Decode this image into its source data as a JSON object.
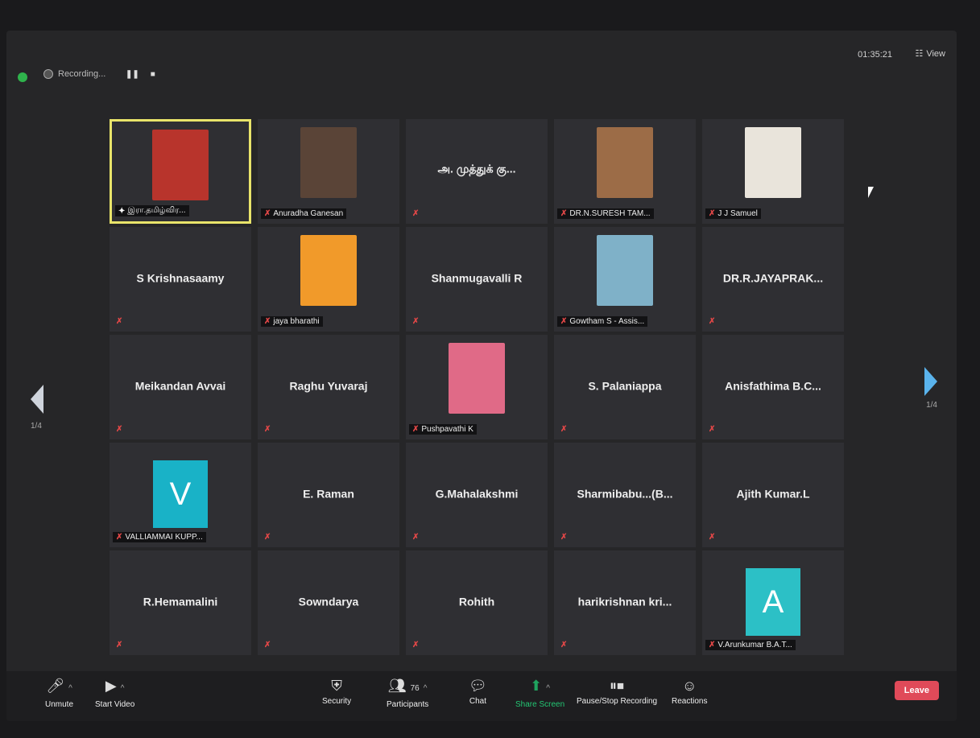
{
  "topbar": {
    "recording_label": "Recording...",
    "pause_icon": "pause-icon",
    "stop_icon": "stop-icon",
    "timer": "01:35:21",
    "view_label": "View"
  },
  "pages": {
    "left": "1/4",
    "right": "1/4"
  },
  "tiles": [
    {
      "name": "இரா.தமிழ்விர...",
      "photo": true,
      "active": true,
      "photo_color": "#b8342c"
    },
    {
      "name": "Anuradha Ganesan",
      "photo": true,
      "photo_color": "#5a4437"
    },
    {
      "name": "அ. முத்துக் கு...",
      "center": true
    },
    {
      "name": "DR.N.SURESH TAM...",
      "photo": true,
      "photo_color": "#9c6c47"
    },
    {
      "name": "J J Samuel",
      "photo": true,
      "photo_color": "#e9e4db"
    },
    {
      "name": "S Krishnasaamy",
      "center": true
    },
    {
      "name": "jaya bharathi",
      "photo": true,
      "photo_color": "#f19a2a"
    },
    {
      "name": "Shanmugavalli R",
      "center": true
    },
    {
      "name": "Gowtham S - Assis...",
      "photo": true,
      "photo_color": "#7fb1c8"
    },
    {
      "name": "DR.R.JAYAPRAK...",
      "center": true
    },
    {
      "name": "Meikandan Avvai",
      "center": true
    },
    {
      "name": "Raghu Yuvaraj",
      "center": true
    },
    {
      "name": "Pushpavathi K",
      "photo": true,
      "photo_color": "#e06a87"
    },
    {
      "name": "S. Palaniappa",
      "center": true
    },
    {
      "name": "Anisfathima B.C...",
      "center": true
    },
    {
      "name": "VALLIAMMAI KUPP...",
      "avatar": "V",
      "avatar_color": "#19b2c7"
    },
    {
      "name": "E. Raman",
      "center": true
    },
    {
      "name": "G.Mahalakshmi",
      "center": true
    },
    {
      "name": "Sharmibabu...(B...",
      "center": true
    },
    {
      "name": "Ajith Kumar.L",
      "center": true
    },
    {
      "name": "R.Hemamalini",
      "center": true
    },
    {
      "name": "Sowndarya",
      "center": true
    },
    {
      "name": "Rohith",
      "center": true
    },
    {
      "name": "harikrishnan kri...",
      "center": true
    },
    {
      "name": "V.Arunkumar B.A.T...",
      "avatar": "A",
      "avatar_color": "#2cc0c6"
    }
  ],
  "toolbar": {
    "unmute": "Unmute",
    "start_video": "Start Video",
    "security": "Security",
    "participants": "Participants",
    "participants_count": "76",
    "chat": "Chat",
    "share_screen": "Share Screen",
    "pause_stop_recording": "Pause/Stop Recording",
    "reactions": "Reactions",
    "leave": "Leave"
  }
}
